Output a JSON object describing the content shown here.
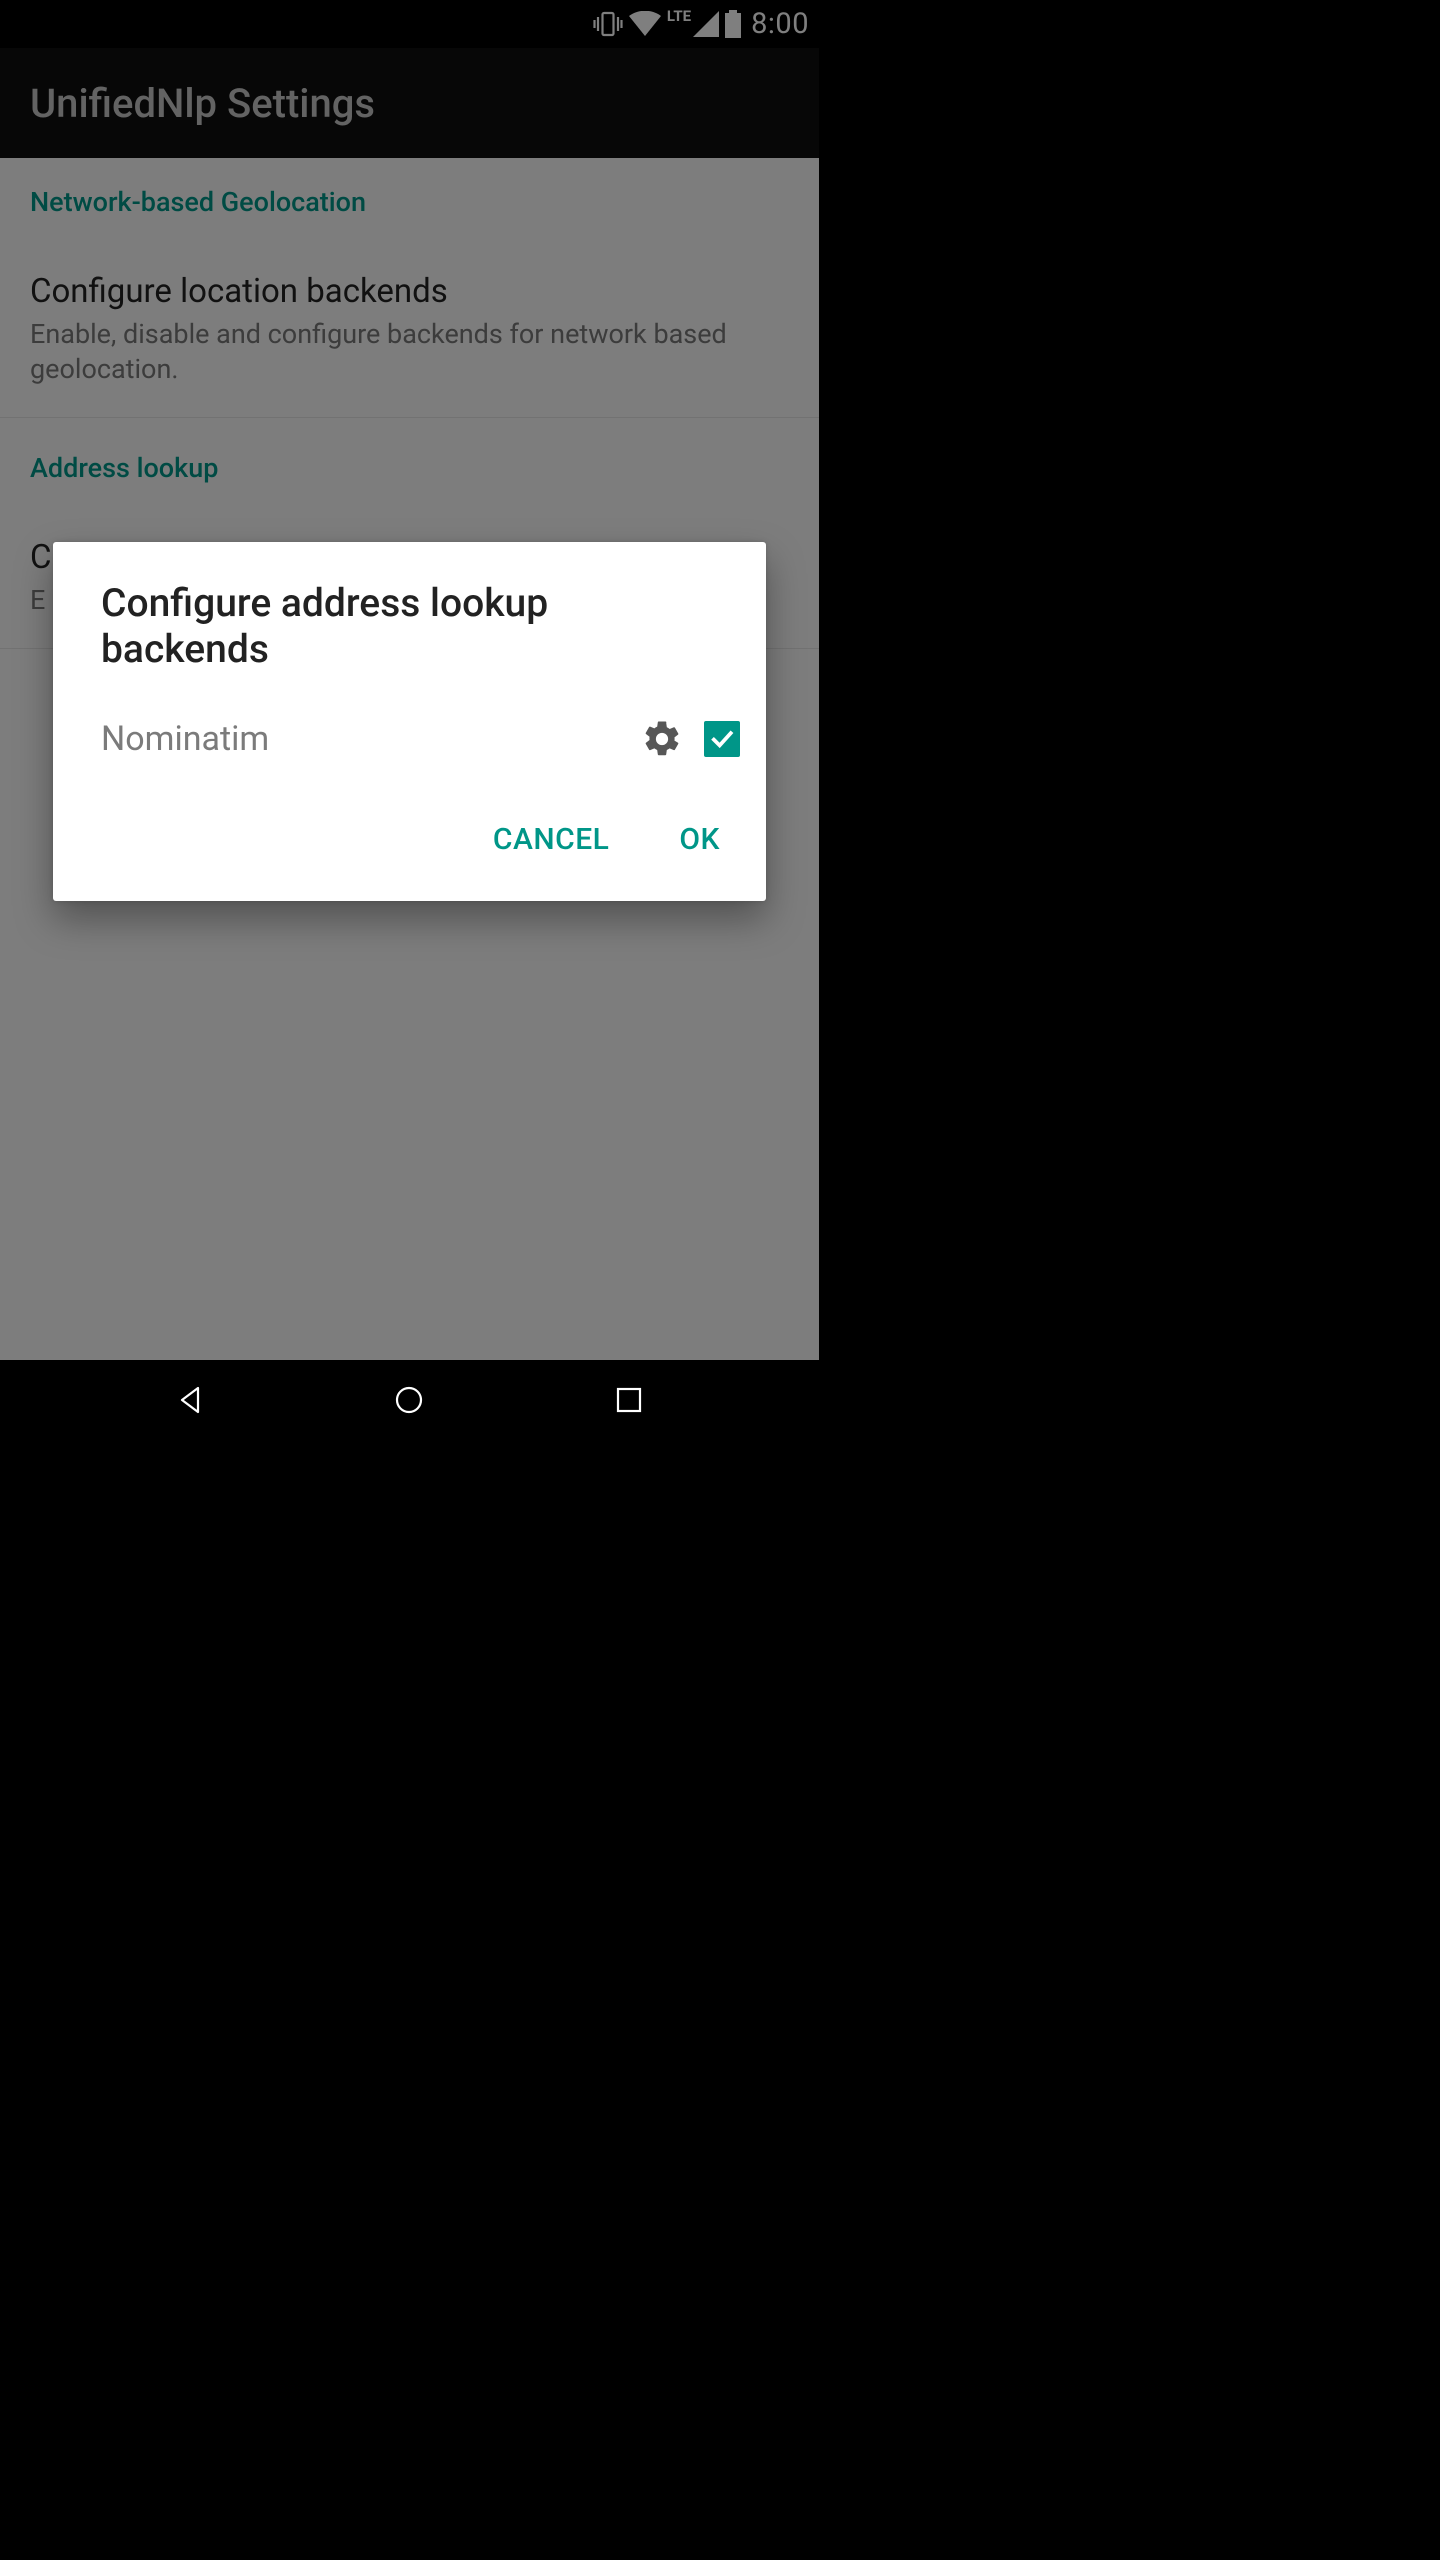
{
  "status": {
    "network_label": "LTE",
    "time": "8:00"
  },
  "appbar": {
    "title": "UnifiedNlp Settings"
  },
  "sections": {
    "geolocation": {
      "header": "Network-based Geolocation",
      "item": {
        "title": "Configure location backends",
        "summary": "Enable, disable and configure backends for network based geolocation."
      }
    },
    "address": {
      "header": "Address lookup",
      "item": {
        "title_fragment_left": "C",
        "summary_fragment_left": "E"
      }
    }
  },
  "dialog": {
    "title": "Configure address lookup backends",
    "backends": [
      {
        "name": "Nominatim",
        "checked": true
      }
    ],
    "cancel": "Cancel",
    "ok": "OK"
  }
}
